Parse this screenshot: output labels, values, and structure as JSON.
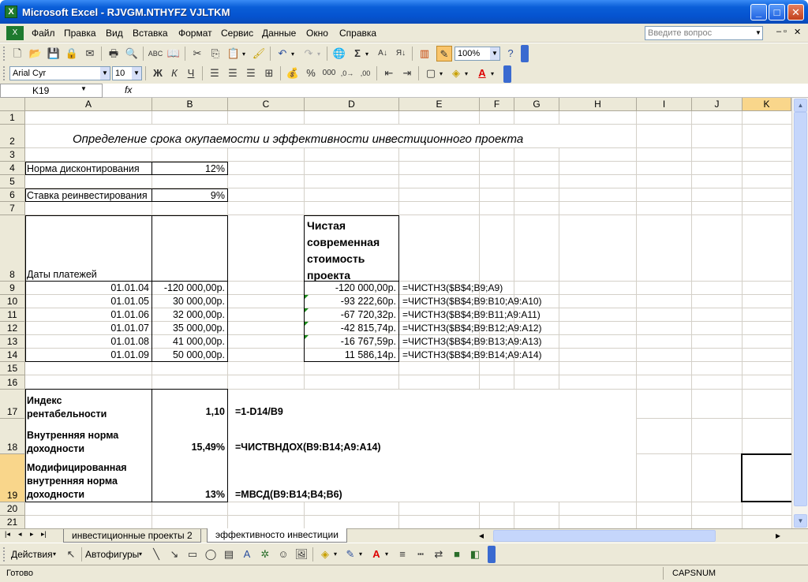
{
  "window": {
    "title": "Microsoft Excel - RJVGM.NTHYFZ VJLTKM"
  },
  "menu": {
    "items": [
      "Файл",
      "Правка",
      "Вид",
      "Вставка",
      "Формат",
      "Сервис",
      "Данные",
      "Окно",
      "Справка"
    ],
    "ask_placeholder": "Введите вопрос"
  },
  "toolbar": {
    "zoom": "100%",
    "font": "Arial Cyr",
    "size": "10"
  },
  "formula_bar": {
    "name_box": "K19",
    "fx": "fx",
    "formula": ""
  },
  "columns": [
    "A",
    "B",
    "C",
    "D",
    "E",
    "F",
    "G",
    "H",
    "I",
    "J",
    "K"
  ],
  "rows": [
    "1",
    "2",
    "3",
    "4",
    "5",
    "6",
    "7",
    "8",
    "9",
    "10",
    "11",
    "12",
    "13",
    "14",
    "15",
    "16",
    "17",
    "18",
    "19",
    "20",
    "21"
  ],
  "sheet": {
    "title": "Определение срока окупаемости и эффективности инвестиционного проекта",
    "discount_label": "Норма дисконтирования",
    "discount_value": "12%",
    "reinvest_label": "Ставка реинвестирования",
    "reinvest_value": "9%",
    "dates_header": "Даты платежей",
    "npv_header": "Чистая современная стоимость проекта",
    "npv_lines": [
      "Чистая",
      "современная",
      "стоимость",
      "проекта"
    ],
    "dates": [
      "01.01.04",
      "01.01.05",
      "01.01.06",
      "01.01.07",
      "01.01.08",
      "01.01.09"
    ],
    "payments": [
      "-120 000,00р.",
      "30 000,00р.",
      "32 000,00р.",
      "35 000,00р.",
      "41 000,00р.",
      "50 000,00р."
    ],
    "npv": [
      "-120 000,00р.",
      "-93 222,60р.",
      "-67 720,32р.",
      "-42 815,74р.",
      "-16 767,59р.",
      "11 586,14р."
    ],
    "npv_formulas": [
      "=ЧИСТНЗ($B$4;B9;A9)",
      "=ЧИСТНЗ($B$4;B9:B10;A9:A10)",
      "=ЧИСТНЗ($B$4;B9:B11;A9:A11)",
      "=ЧИСТНЗ($B$4;B9:B12;A9:A12)",
      "=ЧИСТНЗ($B$4;B9:B13;A9:A13)",
      "=ЧИСТНЗ($B$4;B9:B14;A9:A14)"
    ],
    "pi_label_1": "Индекс",
    "pi_label_2": "рентабельности",
    "pi_value": "1,10",
    "pi_formula": "=1-D14/B9",
    "irr_label_1": "Внутренняя норма",
    "irr_label_2": "доходности",
    "irr_value": "15,49%",
    "irr_formula": "=ЧИСТВНДОХ(B9:B14;A9:A14)",
    "mirr_label_1": "Модифицированная",
    "mirr_label_2": "внутренняя норма",
    "mirr_label_3": "доходности",
    "mirr_value": "13%",
    "mirr_formula": "=МВСД(B9:B14;B4;B6)"
  },
  "tabs": [
    "инвестиционные проекты 2",
    "эффективносто инвестиции"
  ],
  "drawing": {
    "actions": "Действия",
    "autoshapes": "Автофигуры"
  },
  "status": {
    "left": "Готово",
    "caps": "CAPS",
    "num": "NUM"
  }
}
